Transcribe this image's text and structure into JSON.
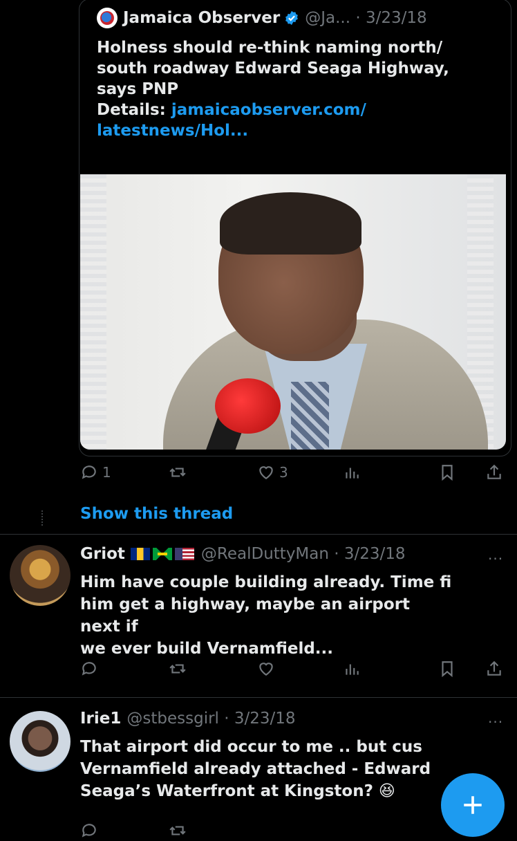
{
  "quote": {
    "author_name": "Jamaica Observer",
    "handle_date": "@Ja... · 3/23/18",
    "text_line1": "Holness should re-think naming north/",
    "text_line2": "south roadway Edward Seaga Highway,",
    "text_line3": "says PNP",
    "details_label": "Details: ",
    "link_line1": "jamaicaobserver.com/",
    "link_line2": "latestnews/Hol...",
    "reply_count": "1",
    "like_count": "3",
    "logo_icon": "jamaica-observer-logo",
    "image_icon": "news-photo-speaker-at-microphone"
  },
  "show_thread": "Show this thread",
  "replies": [
    {
      "name": "Griot",
      "flags": [
        "barbados-flag",
        "jamaica-flag",
        "usa-flag"
      ],
      "handle_date": "@RealDuttyMan · 3/23/18",
      "line1": "Him have couple building already. Time fi",
      "line2": "him get a highway, maybe an airport next if",
      "line3": "we ever build Vernamfield..."
    },
    {
      "name": "Irie1",
      "handle_date": "@stbessgirl · 3/23/18",
      "line1": "That airport did occur to me .. but cus",
      "line2": "Vernamfield already attached - Edward",
      "line3": "Seaga’s Waterfront at Kingston? 😆"
    }
  ],
  "more_label": "···",
  "compose_icon": "plus-icon",
  "colors": {
    "accent": "#1d9bf0",
    "muted": "#71767b",
    "text": "#e7e9ea",
    "bg": "#000000"
  }
}
